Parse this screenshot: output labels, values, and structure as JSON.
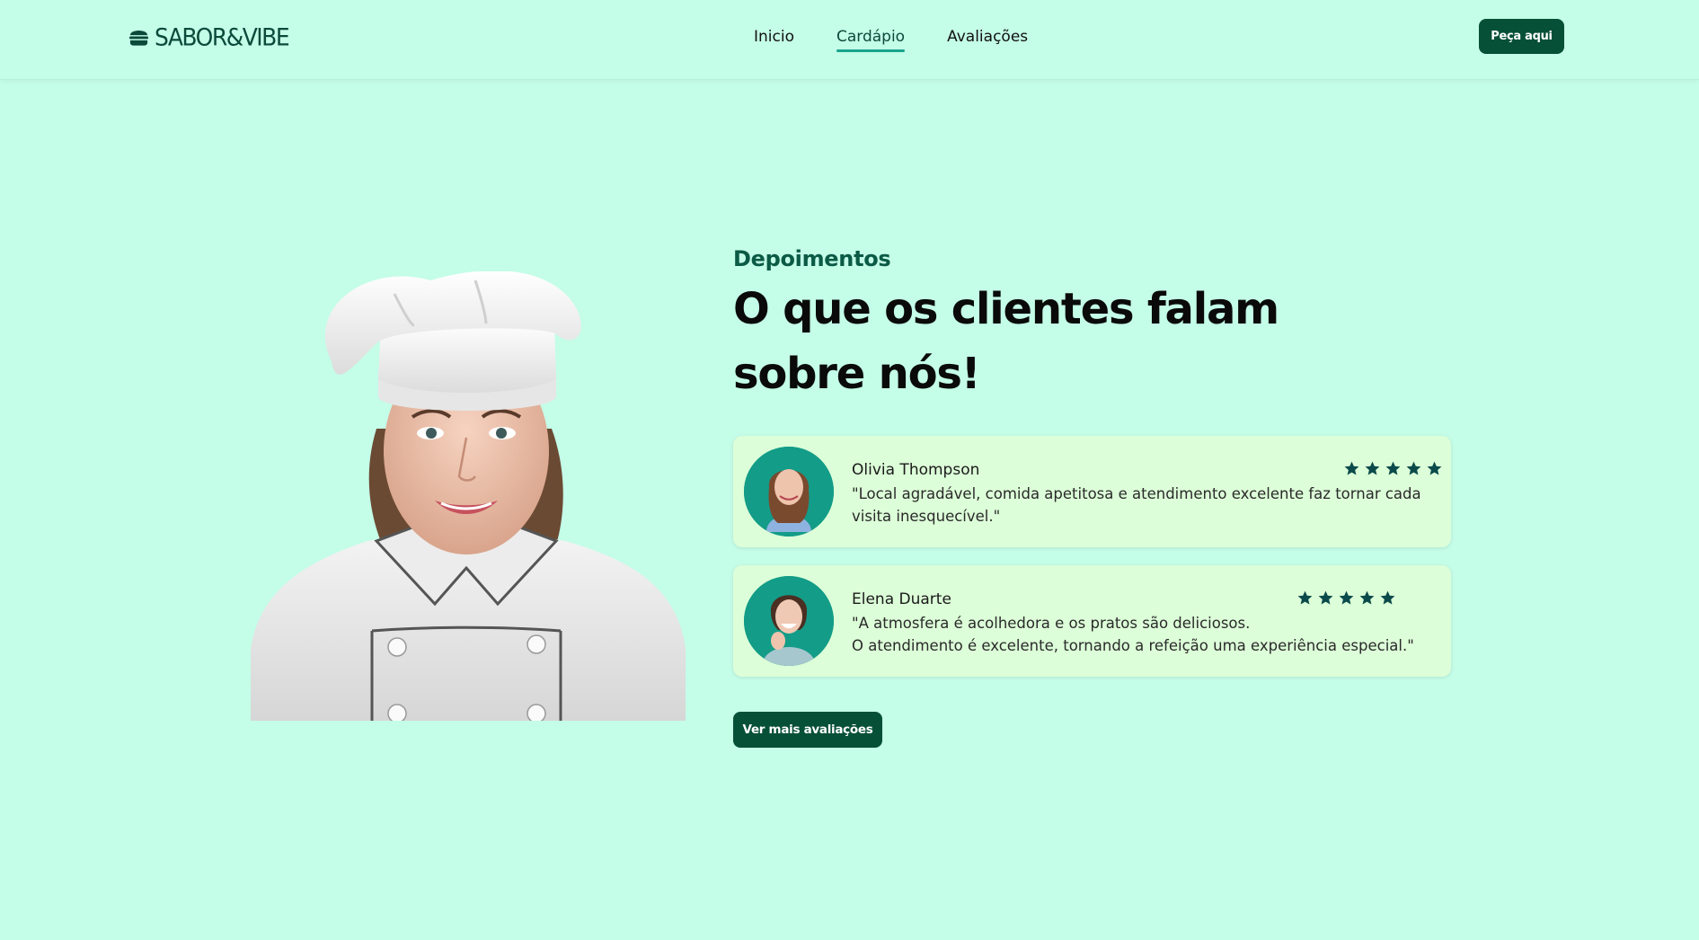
{
  "header": {
    "logo_text": "SABOR&VIBE",
    "logo_icon": "burger-icon",
    "nav": [
      {
        "label": "Inicio",
        "active": false
      },
      {
        "label": "Cardápio",
        "active": true
      },
      {
        "label": "Avaliações",
        "active": false
      }
    ],
    "cta_label": "Peça aqui"
  },
  "section": {
    "eyebrow": "Depoimentos",
    "heading": "O que os clientes falam sobre nós!",
    "reviews": [
      {
        "name": "Olivia Thompson",
        "rating": 5,
        "text": "\"Local agradável, comida apetitosa e atendimento excelente faz tornar cada visita inesquecível.\""
      },
      {
        "name": "Elena Duarte",
        "rating": 5,
        "text_line1": "\"A atmosfera é acolhedora e os pratos são deliciosos.",
        "text_line2": "O atendimento é excelente, tornando a refeição uma experiência especial.\""
      }
    ],
    "more_label": "Ver mais avaliações"
  },
  "colors": {
    "background": "#c4fde8",
    "primary": "#075038",
    "accent": "#18a58b",
    "card": "#dcfed8",
    "star": "#0b4a4a"
  }
}
